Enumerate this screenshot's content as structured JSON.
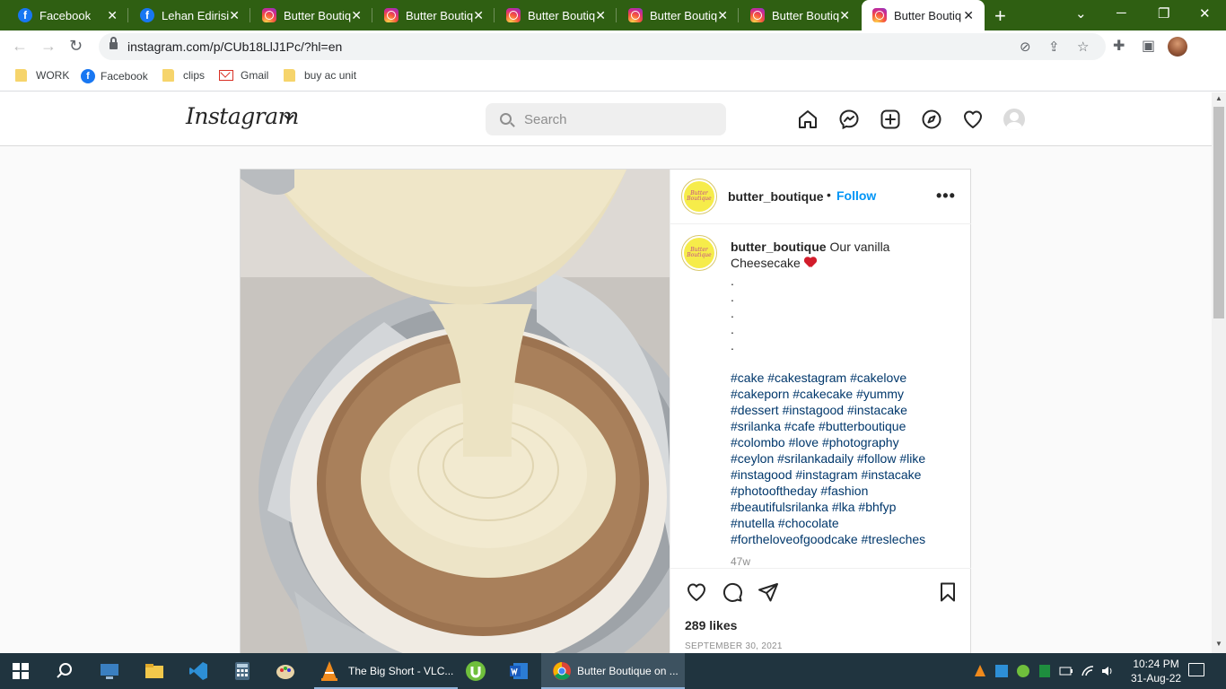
{
  "browser": {
    "tabs": [
      {
        "label": "Facebook",
        "icon": "facebook-icon"
      },
      {
        "label": "Lehan Edirisin",
        "icon": "facebook-icon"
      },
      {
        "label": "Butter Boutiq",
        "icon": "instagram-icon"
      },
      {
        "label": "Butter Boutiq",
        "icon": "instagram-icon"
      },
      {
        "label": "Butter Boutiq",
        "icon": "instagram-icon"
      },
      {
        "label": "Butter Boutiq",
        "icon": "instagram-icon"
      },
      {
        "label": "Butter Boutiq",
        "icon": "instagram-icon"
      },
      {
        "label": "Butter Boutiq",
        "icon": "instagram-icon",
        "active": true
      }
    ],
    "url": "instagram.com/p/CUb18LlJ1Pc/?hl=en",
    "bookmarks": [
      "WORK",
      "Facebook",
      "clips",
      "Gmail",
      "buy ac unit"
    ],
    "tab_strip_color": "#2f5f12"
  },
  "instagram": {
    "logo": "Instagram",
    "search_placeholder": "Search",
    "nav_icons": [
      "home-icon",
      "messenger-icon",
      "new-post-icon",
      "explore-icon",
      "activity-heart-icon",
      "profile-avatar"
    ],
    "post": {
      "username": "butter_boutique",
      "follow_label": "Follow",
      "separator": "•",
      "more_label": "•••",
      "avatar_text": "Butter Boutique",
      "caption_text": "Our vanilla Cheesecake",
      "caption_dots": [
        ".",
        ".",
        ".",
        ".",
        "."
      ],
      "hashtags": "#cake #cakestagram #cakelove #cakeporn #cakecake #yummy #dessert #instagood #instacake #srilanka #cafe #butterboutique #colombo #love #photography #ceylon #srilankadaily #follow #like #instagood #instagram #instacake #photooftheday #fashion #beautifulsrilanka #lka #bhfyp #nutella #chocolate #fortheloveofgoodcake #tresleches",
      "time_ago": "47w",
      "likes": "289 likes",
      "date": "SEPTEMBER 30, 2021",
      "link_color": "#0095f6",
      "hashtag_color": "#00376b"
    }
  },
  "taskbar": {
    "apps": [
      {
        "label": "The Big Short - VLC...",
        "icon": "vlc-icon"
      },
      {
        "label": "Butter Boutique on ...",
        "icon": "chrome-icon",
        "active": true
      }
    ],
    "time": "10:24 PM",
    "date": "31-Aug-22"
  }
}
